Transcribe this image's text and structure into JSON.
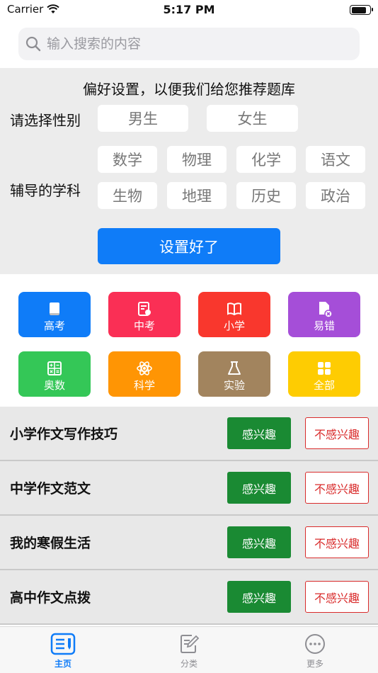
{
  "status_bar": {
    "carrier": "Carrier",
    "time": "5:17 PM",
    "battery_level": 0.85
  },
  "search": {
    "placeholder": "输入搜索的内容",
    "value": ""
  },
  "preferences": {
    "title": "偏好设置，以便我们给您推荐题库",
    "gender_label": "请选择性别",
    "genders": [
      "男生",
      "女生"
    ],
    "subject_label": "辅导的学科",
    "subjects": [
      "数学",
      "物理",
      "化学",
      "语文",
      "生物",
      "地理",
      "历史",
      "政治"
    ],
    "submit_label": "设置好了"
  },
  "categories": [
    {
      "label": "高考",
      "icon": "book-icon",
      "color": "#0f7cf8"
    },
    {
      "label": "中考",
      "icon": "exam-paper-icon",
      "color": "#fa2f55"
    },
    {
      "label": "小学",
      "icon": "open-book-icon",
      "color": "#f9372d"
    },
    {
      "label": "易错",
      "icon": "error-doc-icon",
      "color": "#a54ed8"
    },
    {
      "label": "奥数",
      "icon": "calculator-icon",
      "color": "#34c757"
    },
    {
      "label": "科学",
      "icon": "atom-icon",
      "color": "#ff9504"
    },
    {
      "label": "实验",
      "icon": "flask-icon",
      "color": "#a2845e"
    },
    {
      "label": "全部",
      "icon": "grid-icon",
      "color": "#fecc02"
    }
  ],
  "articles": {
    "interested_label": "感兴趣",
    "not_interested_label": "不感兴趣",
    "items": [
      {
        "title": "小学作文写作技巧"
      },
      {
        "title": "中学作文范文"
      },
      {
        "title": "我的寒假生活"
      },
      {
        "title": "高中作文点拨"
      }
    ]
  },
  "tab_bar": {
    "active_color": "#0f7cf8",
    "inactive_color": "#8e8e93",
    "tabs": [
      {
        "label": "主页",
        "icon": "home-list-icon",
        "active": true
      },
      {
        "label": "分类",
        "icon": "edit-doc-icon",
        "active": false
      },
      {
        "label": "更多",
        "icon": "more-icon",
        "active": false
      }
    ]
  }
}
